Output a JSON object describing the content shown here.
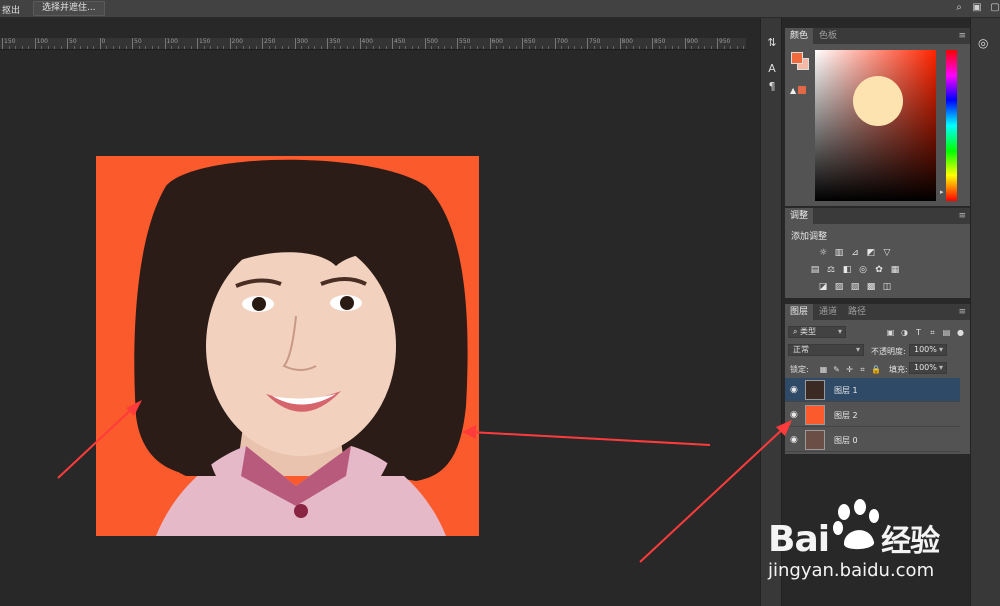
{
  "options_bar": {
    "left_label": "抠出",
    "select_button": "选择并遮住..."
  },
  "ruler": {
    "ticks": [
      "150",
      "100",
      "50",
      "0",
      "50",
      "100",
      "150",
      "200",
      "250",
      "300",
      "350",
      "400",
      "450",
      "500",
      "550",
      "600",
      "650",
      "700",
      "750",
      "800",
      "850",
      "900",
      "950"
    ]
  },
  "color_panel": {
    "tabs": [
      "颜色",
      "色板"
    ],
    "foreground": "#f06a3c",
    "background": "#f3b9a5"
  },
  "adjustments_panel": {
    "tab": "调整",
    "title": "添加调整"
  },
  "layers_panel": {
    "tabs": [
      "图层",
      "通道",
      "路径"
    ],
    "filter_kind": "类型",
    "blend_mode": "正常",
    "opacity_label": "不透明度:",
    "opacity_value": "100%",
    "lock_label": "锁定:",
    "fill_label": "填充:",
    "fill_value": "100%",
    "layers": [
      {
        "name": "图层 1",
        "selected": true,
        "thumb": "portrait"
      },
      {
        "name": "图层 2",
        "selected": false,
        "thumb": "orange"
      },
      {
        "name": "图层 0",
        "selected": false,
        "thumb": "portrait"
      }
    ]
  },
  "canvas": {
    "background_color": "#fb5a2c"
  },
  "watermark": {
    "brand": "Bai",
    "brand_cn": "经验",
    "url": "jingyan.baidu.com"
  }
}
